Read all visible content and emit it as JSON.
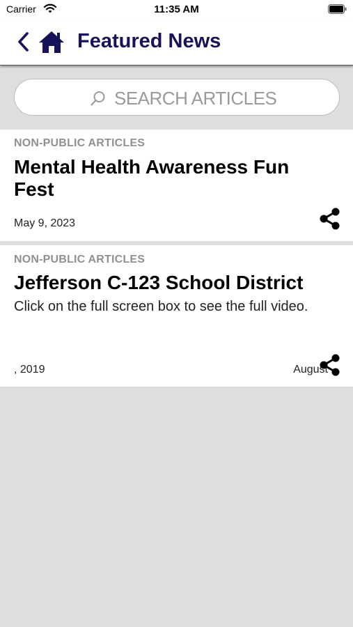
{
  "status_bar": {
    "carrier": "Carrier",
    "time": "11:35 AM"
  },
  "nav": {
    "title": "Featured News",
    "title_color": "#17135a"
  },
  "search": {
    "placeholder": "SEARCH ARTICLES"
  },
  "articles": [
    {
      "category": "NON-PUBLIC ARTICLES",
      "title": "Mental Health Awareness Fun Fest",
      "body": "",
      "date": "May 9, 2023",
      "date_right": ""
    },
    {
      "category": "NON-PUBLIC ARTICLES",
      "title": "Jefferson C-123 School District",
      "body": "Click on the full screen box to see the full video.",
      "date": ", 2019",
      "date_right": "August"
    }
  ]
}
